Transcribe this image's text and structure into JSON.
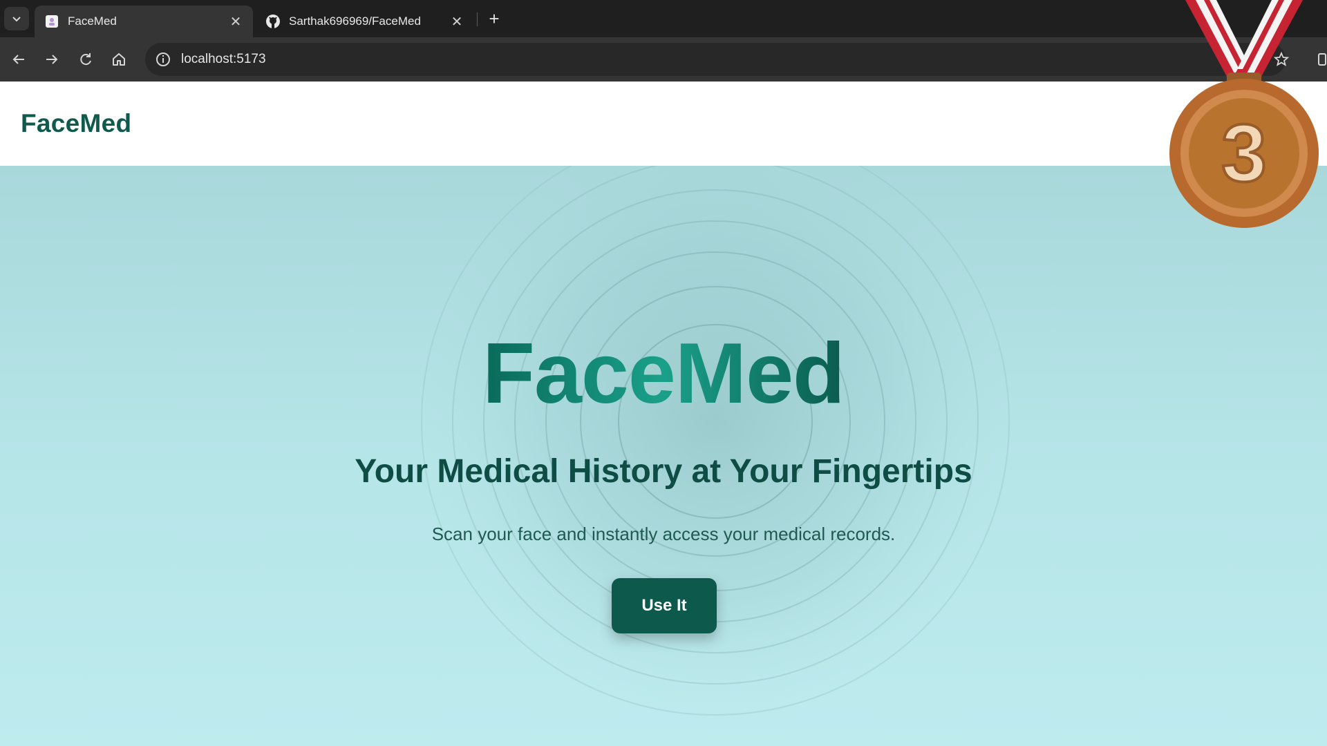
{
  "browser": {
    "tabs": [
      {
        "title": "FaceMed",
        "active": true
      },
      {
        "title": "Sarthak696969/FaceMed",
        "active": false
      }
    ],
    "new_tab": "+",
    "close_glyph": "✕",
    "url": "localhost:5173"
  },
  "app": {
    "brand": "FaceMed",
    "hero": {
      "title": "FaceMed",
      "subtitle": "Your Medical History at Your Fingertips",
      "description": "Scan your face and instantly access your medical records.",
      "cta_label": "Use It"
    }
  },
  "overlay": {
    "medal_number": "3"
  },
  "colors": {
    "brand": "#0f5a4d",
    "button": "#0d5a4d",
    "hero_bg": "#b6e5e8",
    "chrome_dark": "#1f1f1f"
  }
}
